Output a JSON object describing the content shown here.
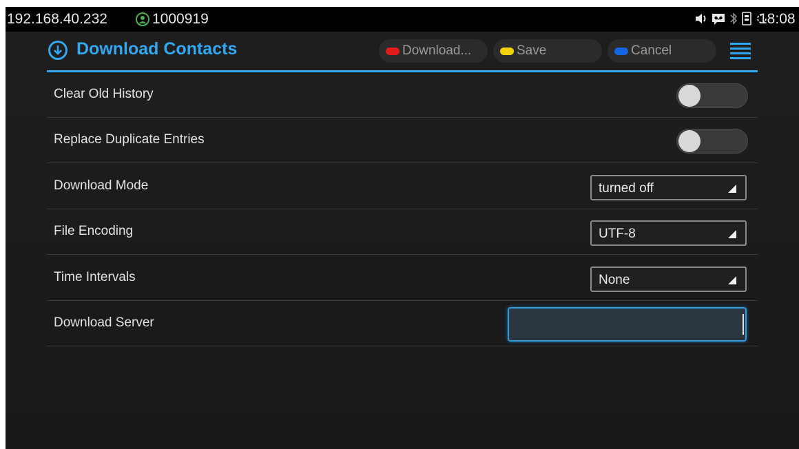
{
  "status_bar": {
    "ip_address": "192.168.40.232",
    "account": "1000919",
    "account_icon": "person-circle-icon",
    "icons": [
      "volume-icon",
      "voicemail-icon",
      "bluetooth-icon",
      "sim-icon",
      "sync-icon"
    ],
    "time": "18:08"
  },
  "header": {
    "title": "Download Contacts",
    "title_icon": "download-circle-icon",
    "softkeys": [
      {
        "label": "Download...",
        "color": "#e01b1b"
      },
      {
        "label": "Save",
        "color": "#f2d40a"
      },
      {
        "label": "Cancel",
        "color": "#1565e0"
      }
    ],
    "menu_icon": "menu-icon",
    "accent_color": "#33a6f0"
  },
  "settings": {
    "clear_old_history": {
      "label": "Clear Old History",
      "enabled": false
    },
    "replace_duplicate_entries": {
      "label": "Replace Duplicate Entries",
      "enabled": false
    },
    "download_mode": {
      "label": "Download Mode",
      "value": "turned off"
    },
    "file_encoding": {
      "label": "File Encoding",
      "value": "UTF-8"
    },
    "time_intervals": {
      "label": "Time Intervals",
      "value": "None"
    },
    "download_server": {
      "label": "Download Server",
      "value": ""
    }
  }
}
